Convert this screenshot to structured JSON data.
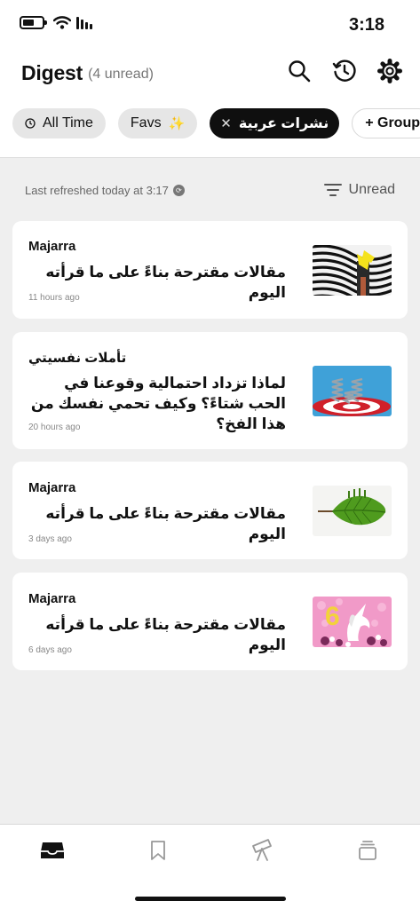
{
  "status_bar": {
    "time": "3:18"
  },
  "header": {
    "title": "Digest",
    "unread": "(4 unread)",
    "icons": [
      "search-icon",
      "history-icon",
      "settings-icon"
    ]
  },
  "chips": {
    "all_time": "All Time",
    "favs": "Favs",
    "favs_emoji": "✨",
    "arabic": "نشرات عربية",
    "close_glyph": "✕",
    "group": "+ Group"
  },
  "refresh": {
    "text": "Last refreshed today at 3:17",
    "filter_label": "Unread"
  },
  "cards": [
    {
      "source": "Majarra",
      "headline": "مقالات مقترحة بناءً على ما قرأته اليوم",
      "age": "11 hours ago",
      "thumb": "zebra-pattern-image"
    },
    {
      "source": "تأملات نفسيتي",
      "headline": "لماذا تزداد احتمالية وقوعنا في الحب شتاءً؟ وكيف تحمي نفسك من هذا الفخ؟",
      "age": "20 hours ago",
      "thumb": "springs-target-image"
    },
    {
      "source": "Majarra",
      "headline": "مقالات مقترحة بناءً على ما قرأته اليوم",
      "age": "3 days ago",
      "thumb": "green-leaf-image"
    },
    {
      "source": "Majarra",
      "headline": "مقالات مقترحة بناءً على ما قرأته اليوم",
      "age": "6 days ago",
      "thumb": "unicorn-pink-image"
    }
  ],
  "tabbar": {
    "icons": [
      "inbox-icon",
      "bookmark-icon",
      "telescope-icon",
      "stack-icon"
    ]
  },
  "colors": {
    "active_chip": "#0f0f0f",
    "background": "#efefef",
    "favs_sparkle": "#f1c21b"
  }
}
